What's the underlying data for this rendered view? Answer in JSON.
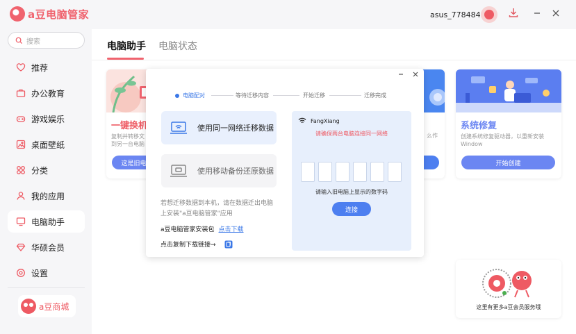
{
  "app": {
    "title": "a豆电脑管家",
    "user_name": "asus_77848458"
  },
  "search": {
    "placeholder": "搜索"
  },
  "sidebar": {
    "items": [
      {
        "label": "推荐"
      },
      {
        "label": "办公教育"
      },
      {
        "label": "游戏娱乐"
      },
      {
        "label": "桌面壁纸"
      },
      {
        "label": "分类"
      },
      {
        "label": "我的应用"
      },
      {
        "label": "电脑助手"
      },
      {
        "label": "华硕会员"
      },
      {
        "label": "设置"
      }
    ],
    "active": "电脑助手",
    "shop_label": "a豆商城"
  },
  "main": {
    "tabs": [
      {
        "label": "电脑助手"
      },
      {
        "label": "电脑状态"
      }
    ],
    "cards": [
      {
        "title": "一键换机",
        "desc_1": "复制并转移文",
        "desc_2": "到另一台电脑",
        "button": "这是旧电脑"
      },
      {
        "desc_1": "",
        "desc_2": "",
        "button": ""
      },
      {
        "title": "系统修复",
        "desc_1": "创建系统修复驱动器，以重新安装",
        "desc_2": "Window",
        "button": "开始创建"
      }
    ],
    "partial_card_text": "么作",
    "promo_text": "这里有更多a豆会员服务哦"
  },
  "modal": {
    "steps": [
      "电脑配对",
      "等待迁移内容",
      "开始迁移",
      "迁移完成"
    ],
    "option_same_network": "使用同一网络迁移数据",
    "option_mobile_backup": "使用移动备份还原数据",
    "info_line_1": "若想迁移数据到本机，请在数据迁出电脑",
    "info_line_2": "上安装\"a豆电脑管家\"应用",
    "package_label": "a豆电脑管家安装包",
    "download_link": "点击下载",
    "copy_label": "点击复制下载链接→",
    "network_name": "FangXiang",
    "network_warning": "请确保两台电脑连接同一网络",
    "code_hint": "请输入旧电脑上显示的数字码",
    "connect_button": "连接"
  },
  "colors": {
    "brand": "#f0636e",
    "accent_blue": "#4d7ff0",
    "step_active": "#3b78e7",
    "card_button_blue": "#6b86f2"
  }
}
